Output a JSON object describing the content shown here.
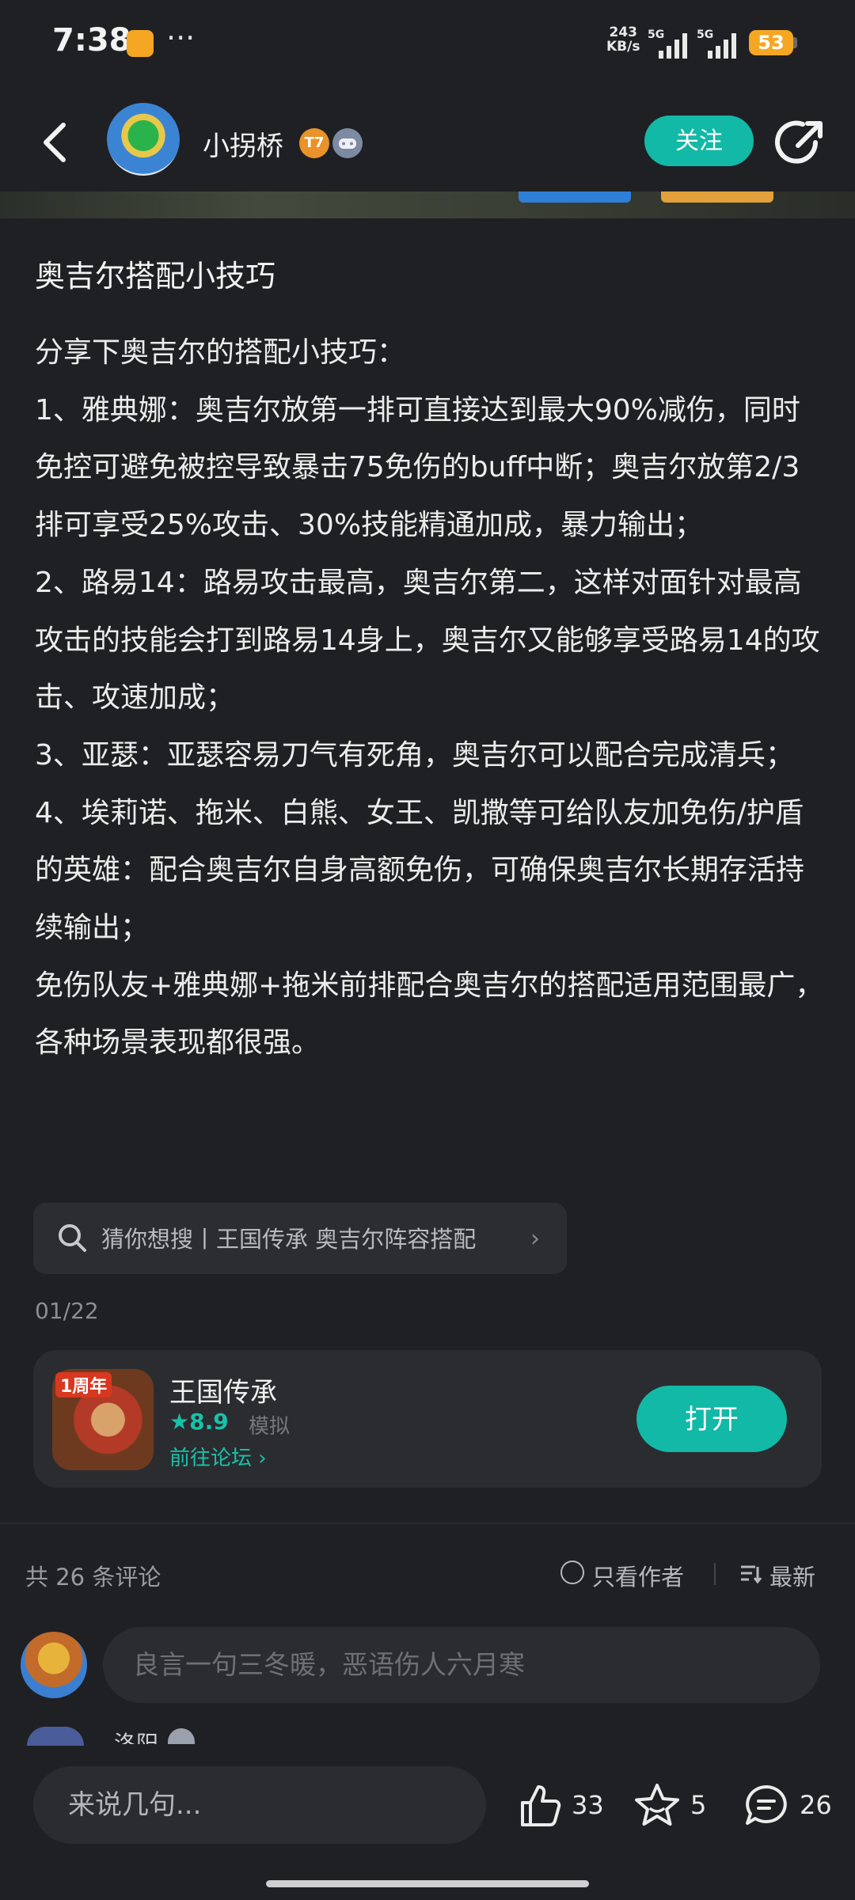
{
  "status_bar": {
    "time": "7:38",
    "more": "···",
    "net_speed_value": "243",
    "net_speed_unit": "KB/s",
    "signal1": "5G",
    "signal2": "5G",
    "battery": "53"
  },
  "header": {
    "username": "小拐桥",
    "level_badge": "T7",
    "follow_label": "关注"
  },
  "article": {
    "title": "奥吉尔搭配小技巧",
    "paragraphs": [
      "分享下奥吉尔的搭配小技巧：",
      "1、雅典娜：奥吉尔放第一排可直接达到最大90%减伤，同时免控可避免被控导致暴击75免伤的buff中断；奥吉尔放第2/3排可享受25%攻击、30%技能精通加成，暴力输出；",
      "2、路易14：路易攻击最高，奥吉尔第二，这样对面针对最高攻击的技能会打到路易14身上，奥吉尔又能够享受路易14的攻击、攻速加成；",
      "3、亚瑟：亚瑟容易刀气有死角，奥吉尔可以配合完成清兵；",
      "4、埃莉诺、拖米、白熊、女王、凯撒等可给队友加免伤/护盾的英雄：配合奥吉尔自身高额免伤，可确保奥吉尔长期存活持续输出；",
      "免伤队友+雅典娜+拖米前排配合奥吉尔的搭配适用范围最广，各种场景表现都很强。"
    ],
    "search_suggestion": "猜你想搜丨王国传承 奥吉尔阵容搭配",
    "date": "01/22"
  },
  "app_card": {
    "icon_tag": "1周年",
    "name": "王国传承",
    "rating": "★8.9",
    "genre": "模拟",
    "forum_link": "前往论坛 ›",
    "open_label": "打开"
  },
  "comments": {
    "count_label": "共 26 条评论",
    "author_only_label": "只看作者",
    "sort_label": "最新",
    "input_placeholder": "良言一句三冬暖，恶语伤人六月寒",
    "peek_name": "洛阳"
  },
  "bottom_bar": {
    "say_placeholder": "来说几句...",
    "likes": "33",
    "favorites": "5",
    "comments": "26"
  },
  "colors": {
    "accent": "#12b9a6",
    "background": "#1f2023",
    "card": "#2b2c30",
    "battery": "#f5a623"
  },
  "icons": {
    "back": "back-arrow-icon",
    "share": "share-icon",
    "search": "search-icon",
    "like": "thumbs-up-icon",
    "favorite": "star-icon",
    "comment": "comment-icon",
    "sort": "sort-icon"
  }
}
